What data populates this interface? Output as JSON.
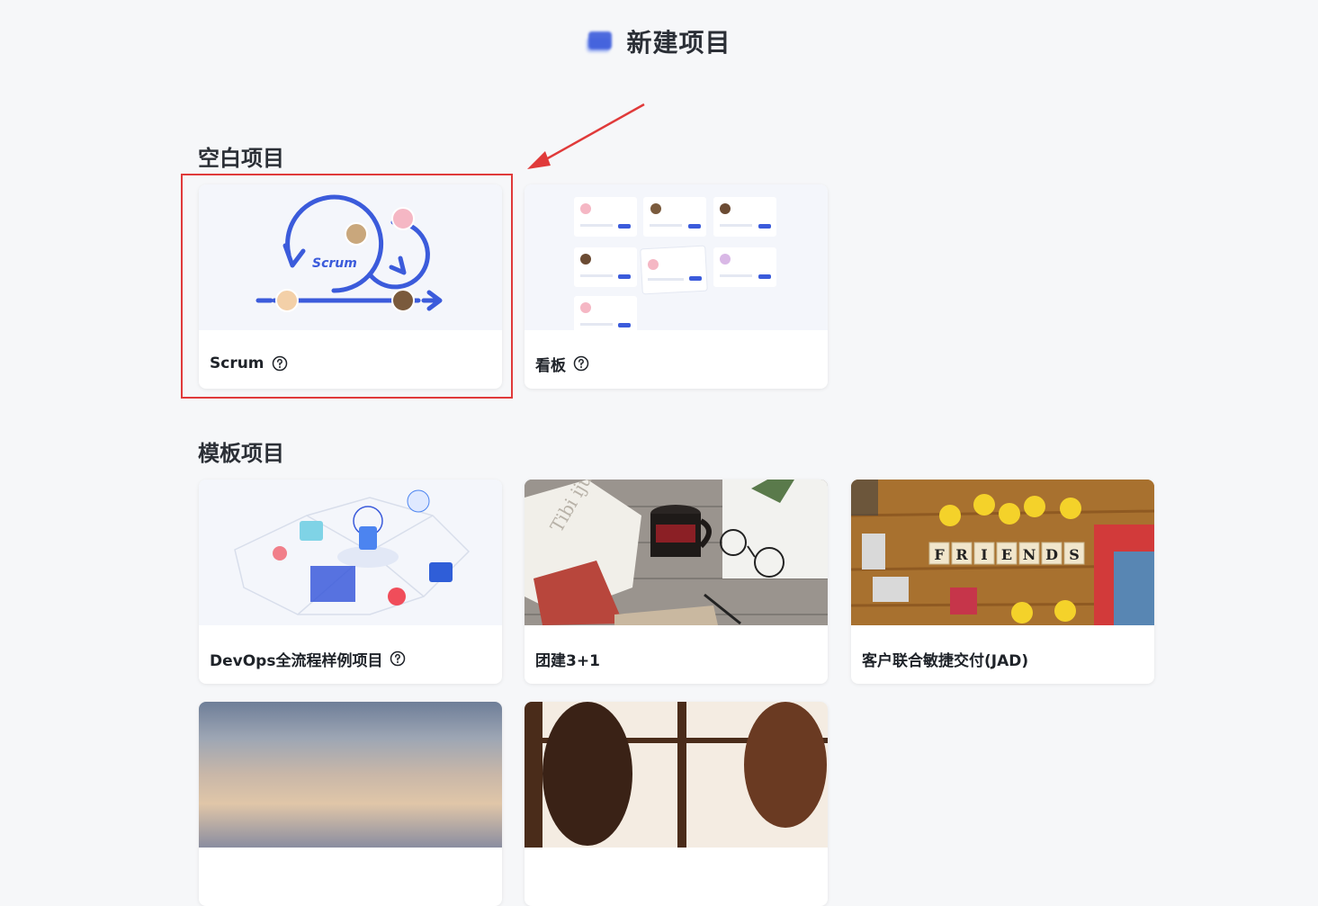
{
  "header": {
    "logo_icon": "project-logo-icon",
    "title": "新建项目"
  },
  "blank_section": {
    "title": "空白项目",
    "cards": [
      {
        "label": "Scrum",
        "scrum_word": "Scrum",
        "help_icon": "question-circle-icon"
      },
      {
        "label": "看板",
        "help_icon": "question-circle-icon"
      }
    ]
  },
  "template_section": {
    "title": "模板项目",
    "cards": [
      {
        "label": "DevOps全流程样例项目",
        "help_icon": "question-circle-icon"
      },
      {
        "label": "团建3+1",
        "book_text": "Tibi ijudi"
      },
      {
        "label": "客户联合敏捷交付(JAD)",
        "tiles": [
          "F",
          "R",
          "I",
          "E",
          "N",
          "D",
          "S"
        ]
      },
      {
        "label": ""
      },
      {
        "label": ""
      }
    ]
  },
  "annotation": {
    "highlight_color": "#e03a3a"
  },
  "colors": {
    "accent": "#3b5bdb",
    "background": "#f6f7f9"
  }
}
